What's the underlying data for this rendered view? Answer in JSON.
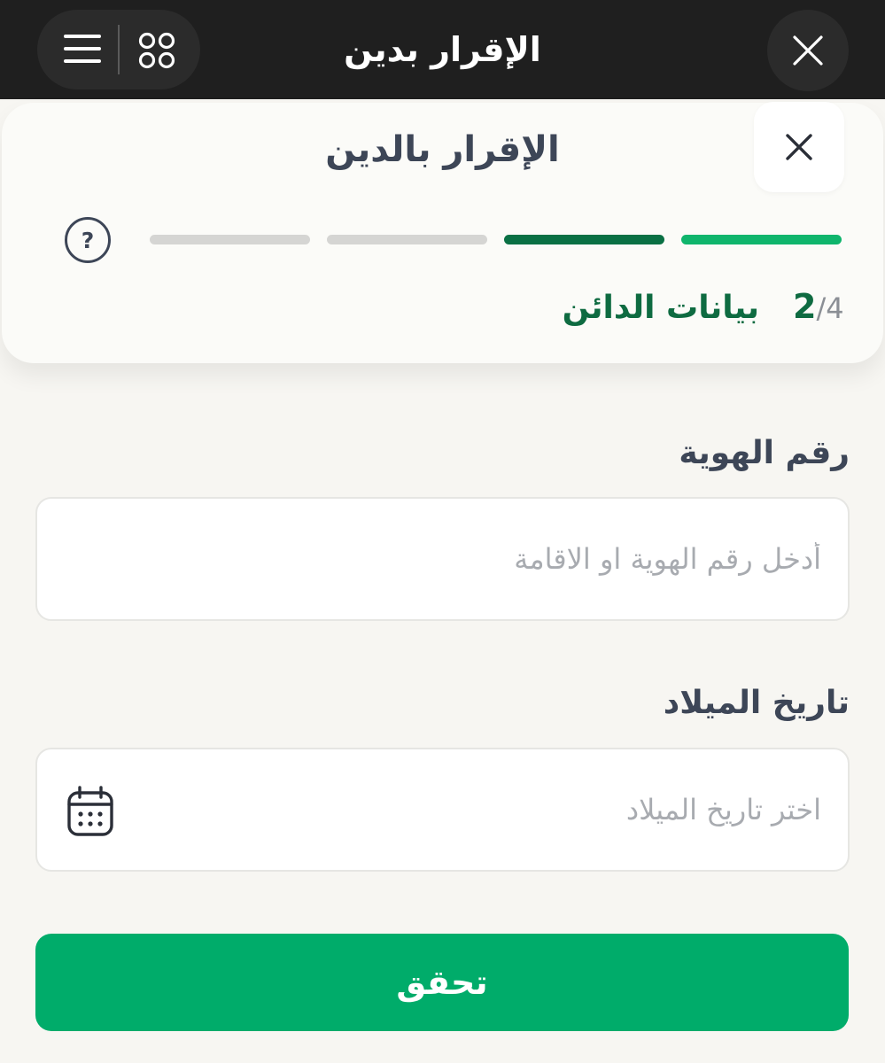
{
  "top_bar": {
    "title": "الإقرار بدين",
    "close_icon": "close-icon",
    "menu_icon": "hamburger-menu-icon",
    "apps_icon": "apps-grid-icon"
  },
  "card": {
    "title": "الإقرار بالدين",
    "close_icon": "close-icon",
    "help_icon": "help-circle-icon",
    "progress": {
      "current": "2",
      "separator": "/",
      "total": "4",
      "step_label": "بيانات الدائن",
      "segments": [
        "complete",
        "current",
        "pending",
        "pending"
      ]
    }
  },
  "form": {
    "id_number": {
      "label": "رقم الهوية",
      "value": "",
      "placeholder": "أدخل رقم الهوية او الاقامة"
    },
    "birth_date": {
      "label": "تاريخ الميلاد",
      "value": "",
      "placeholder": "اختر تاريخ الميلاد",
      "icon": "calendar-icon"
    },
    "submit_label": "تحقق"
  },
  "colors": {
    "accent_green": "#00ac6a",
    "dark_green": "#0e6b41",
    "step_complete": "#0fb56c",
    "step_current": "#0a7044",
    "step_pending": "#d5d5d3",
    "topbar_background": "#1f1f1f",
    "page_background": "#f7f6f2"
  }
}
